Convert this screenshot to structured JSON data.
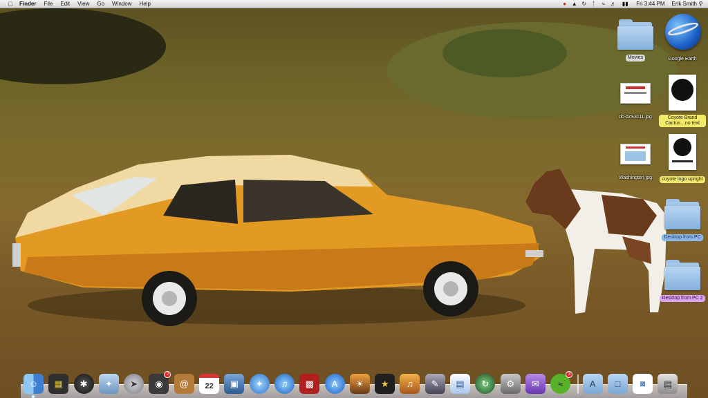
{
  "menubar": {
    "apple_label": "",
    "app_name": "Finder",
    "menus": [
      "File",
      "Edit",
      "View",
      "Go",
      "Window",
      "Help"
    ],
    "clock": "Fri 3:44 PM",
    "user": "Erik Smith"
  },
  "desktop_icons": {
    "movies": "Movies",
    "google_earth": "Google Earth",
    "dc_jpg": "dc-bzS3111.jpg",
    "coyote_cactus": "Coyote Brand Cactus…no text",
    "washington_jpg": "Washington.jpg",
    "coyote_logo": "coyote logo upright",
    "desktop_pc_1": "Desktop from PC",
    "desktop_pc_2": "Desktop from PC 2"
  },
  "dock": {
    "facetime_badge": "2",
    "calendar_day": "22",
    "spotify_badge": "3"
  },
  "colors": {
    "menubar": "#e8e8e8",
    "folder_blue": "#86b1de",
    "car_orange": "#e39a23",
    "badge_red": "#e02222"
  }
}
